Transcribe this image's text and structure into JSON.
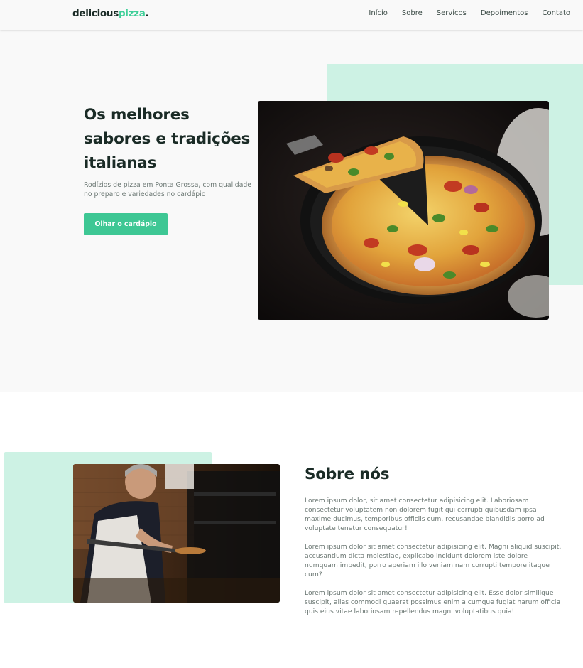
{
  "header": {
    "logo_main": "delicious",
    "logo_accent": "pizza",
    "logo_dot": ".",
    "nav": [
      "Início",
      "Sobre",
      "Serviços",
      "Depoimentos",
      "Contato"
    ]
  },
  "hero": {
    "title": "Os melhores sabores e tradições italianas",
    "subtitle": "Rodízios de pizza em Ponta Grossa, com qualidade no preparo e variedades no cardápio",
    "button_label": "Olhar o cardápio"
  },
  "about": {
    "title": "Sobre nós",
    "paragraphs": [
      "Lorem ipsum dolor, sit amet consectetur adipisicing elit. Laboriosam consectetur voluptatem non dolorem fugit qui corrupti quibusdam ipsa maxime ducimus, temporibus officiis cum, recusandae blanditiis porro ad voluptate tenetur consequatur!",
      "Lorem ipsum dolor sit amet consectetur adipisicing elit. Magni aliquid suscipit, accusantium dicta molestiae, explicabo incidunt dolorem iste dolore numquam impedit, porro aperiam illo veniam nam corrupti tempore itaque cum?",
      "Lorem ipsum dolor sit amet consectetur adipisicing elit. Esse dolor similique suscipit, alias commodi quaerat possimus enim a cumque fugiat harum officia quis eius vitae laboriosam repellendus magni voluptatibus quia!"
    ]
  },
  "colors": {
    "accent": "#3ec794",
    "accent_light": "#cdf2e4",
    "heading": "#1a2b26",
    "body_text": "#6b7773",
    "hero_bg": "#f9f9f9"
  }
}
